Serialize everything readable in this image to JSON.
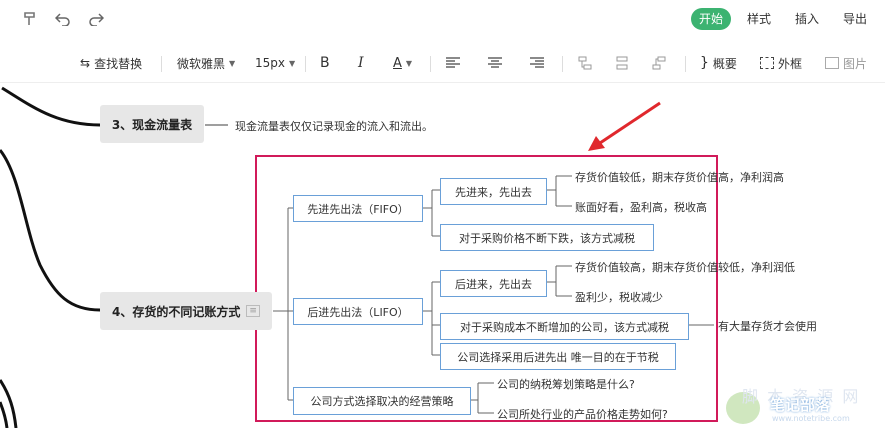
{
  "topbar": {
    "icons": [
      "format-painter-icon",
      "undo-icon",
      "redo-icon"
    ],
    "tabs": [
      "开始",
      "样式",
      "插入",
      "导出"
    ],
    "active_color": "#3cb371"
  },
  "toolbar": {
    "find_replace": "查找替换",
    "font_family": "微软雅黑",
    "font_size": "15px",
    "bold": "B",
    "italic": "I",
    "font_color": "A",
    "summary": "概要",
    "frame": "外框",
    "image": "图片"
  },
  "mindmap": {
    "node3": "3、现金流量表",
    "node3_note": "现金流量表仅仅记录现金的流入和流出。",
    "node4": "4、存货的不同记账方式",
    "fifo": "先进先出法（FIFO）",
    "fifo_sub": "先进来，先出去",
    "fifo_leaf1": "存货价值较低，期末存货价值高，净利润高",
    "fifo_leaf2": "账面好看，盈利高，税收高",
    "fifo_sub2": "对于采购价格不断下跌，该方式减税",
    "lifo": "后进先出法（LIFO）",
    "lifo_sub": "后进来，先出去",
    "lifo_leaf1": "存货价值较高，期末存货价值较低，净利润低",
    "lifo_leaf2": "盈利少，税收减少",
    "lifo_sub2": "对于采购成本不断增加的公司，该方式减税",
    "lifo_sub2_note": "有大量存货才会使用",
    "lifo_sub3": "公司选择采用后进先出 唯一目的在于节税",
    "strategy": "公司方式选择取决的经营策略",
    "strategy_q1": "公司的纳税筹划策略是什么?",
    "strategy_q2": "公司所处行业的产品价格走势如何?"
  },
  "highlight_color": "#d11a5a",
  "arrow_color": "#e0282d",
  "watermark": {
    "line1": "脚 本 资 源 网",
    "line2": "笔记部落",
    "line3": "www.notetribe.com"
  }
}
